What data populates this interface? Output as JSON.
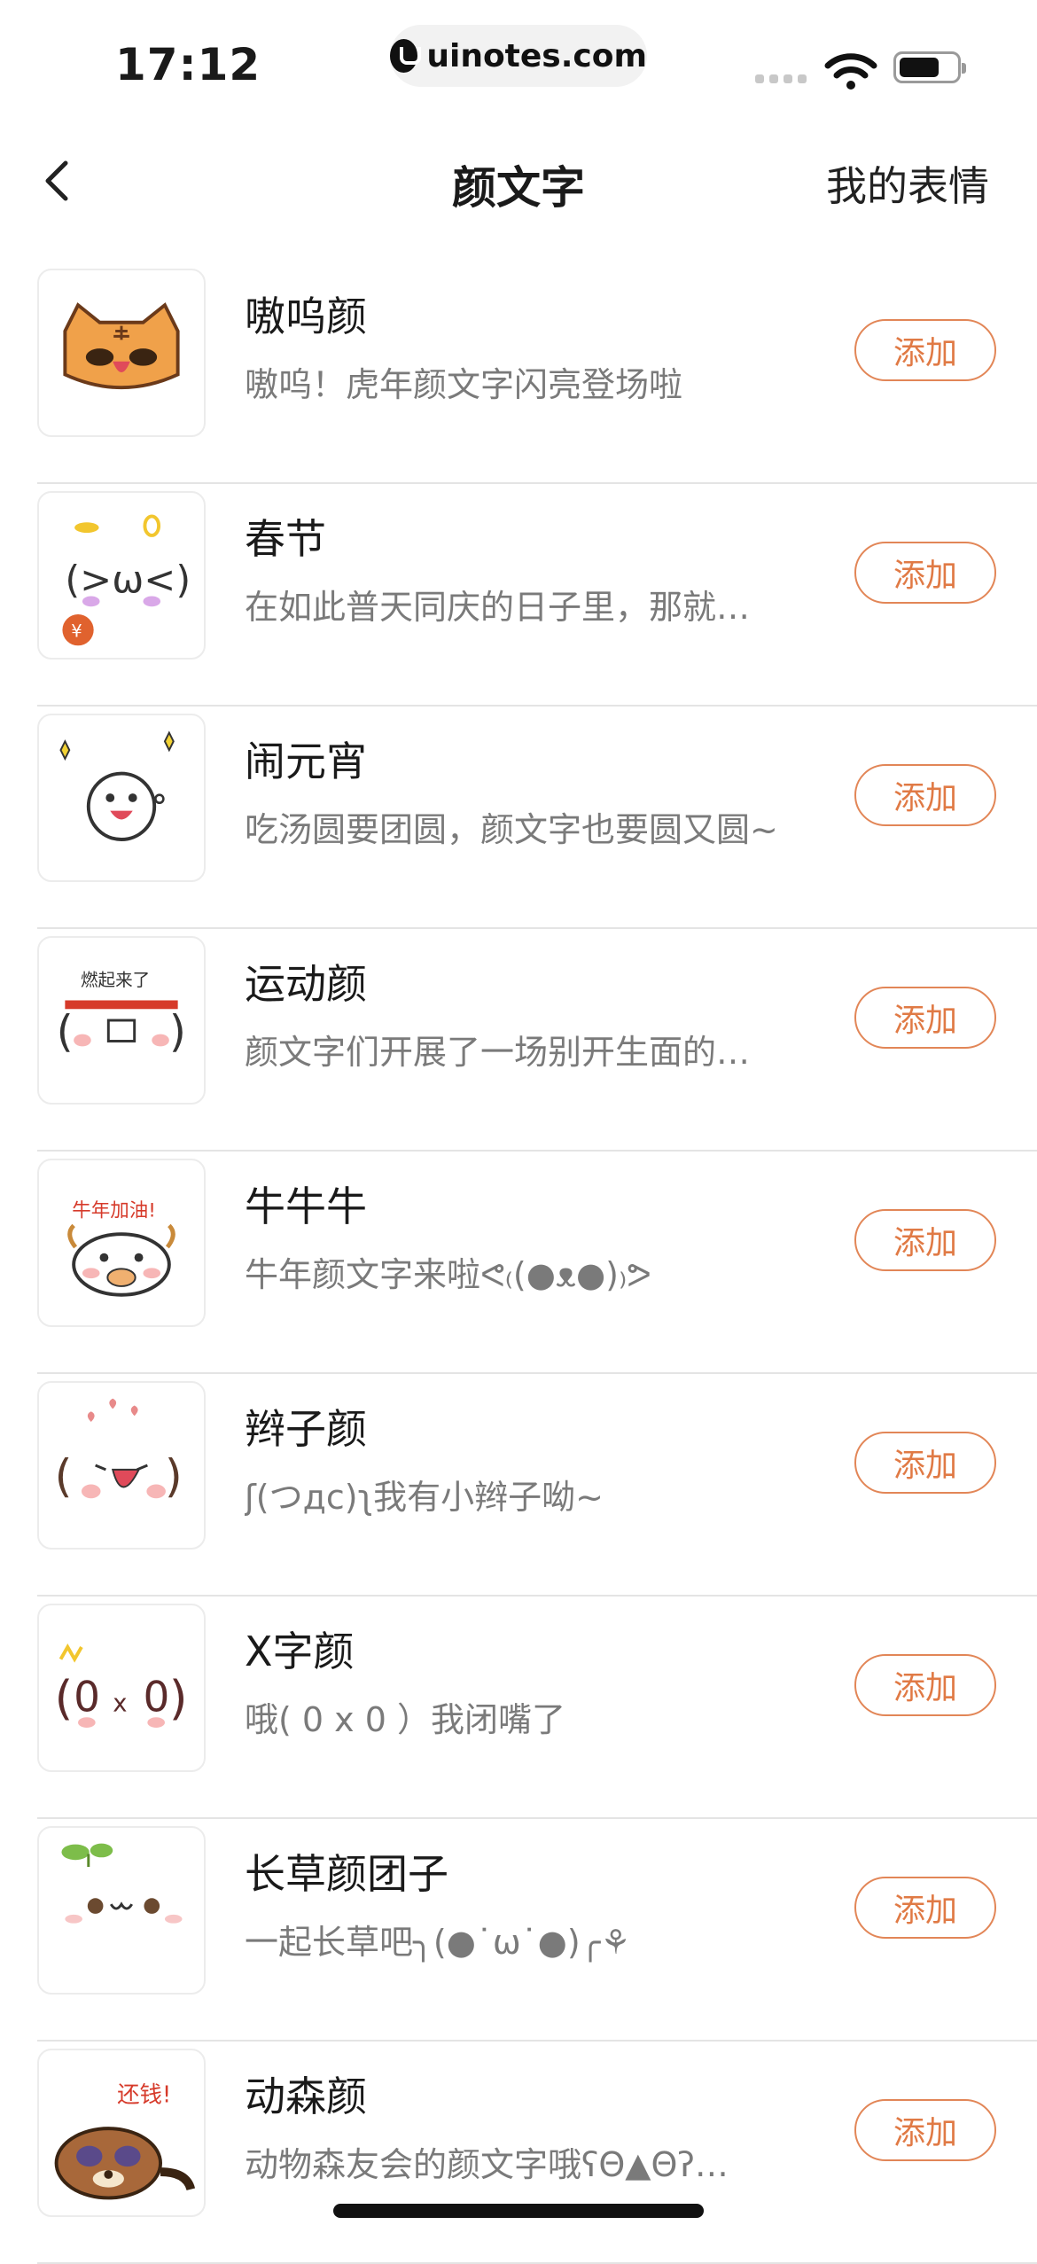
{
  "status_bar": {
    "time": "17:12",
    "url": "uinotes.com"
  },
  "nav": {
    "title": "颜文字",
    "right_action": "我的表情"
  },
  "items": [
    {
      "name": "嗷呜颜",
      "desc": "嗷呜！虎年颜文字闪亮登场啦",
      "button": "添加",
      "icon": "tiger-face-icon"
    },
    {
      "name": "春节",
      "desc": "在如此普天同庆的日子里，那就…",
      "button": "添加",
      "icon": "new-year-face-icon"
    },
    {
      "name": "闹元宵",
      "desc": "吃汤圆要团圆，颜文字也要圆又圆~",
      "button": "添加",
      "icon": "lantern-festival-face-icon"
    },
    {
      "name": "运动颜",
      "desc": "颜文字们开展了一场别开生面的…",
      "button": "添加",
      "icon": "sport-face-icon",
      "caption": "燃起来了"
    },
    {
      "name": "牛牛牛",
      "desc": "牛年颜文字来啦ᕙ₍(●ᴥ●)₎ᕗ",
      "button": "添加",
      "icon": "ox-face-icon",
      "caption": "牛年加油!"
    },
    {
      "name": "辫子颜",
      "desc": "ʃ(つдc)ʅ我有小辫子呦~",
      "button": "添加",
      "icon": "braid-face-icon"
    },
    {
      "name": "X字颜",
      "desc": "哦( 0 x 0 ）我闭嘴了",
      "button": "添加",
      "icon": "x-mouth-face-icon"
    },
    {
      "name": "长草颜团子",
      "desc": "一起长草吧╮(●˙ω˙●)╭⚘",
      "button": "添加",
      "icon": "sprout-face-icon"
    },
    {
      "name": "动森颜",
      "desc": "动物森友会的颜文字哦ʕΘ▲Θʔ…",
      "button": "添加",
      "icon": "raccoon-face-icon",
      "caption": "还钱!"
    }
  ]
}
